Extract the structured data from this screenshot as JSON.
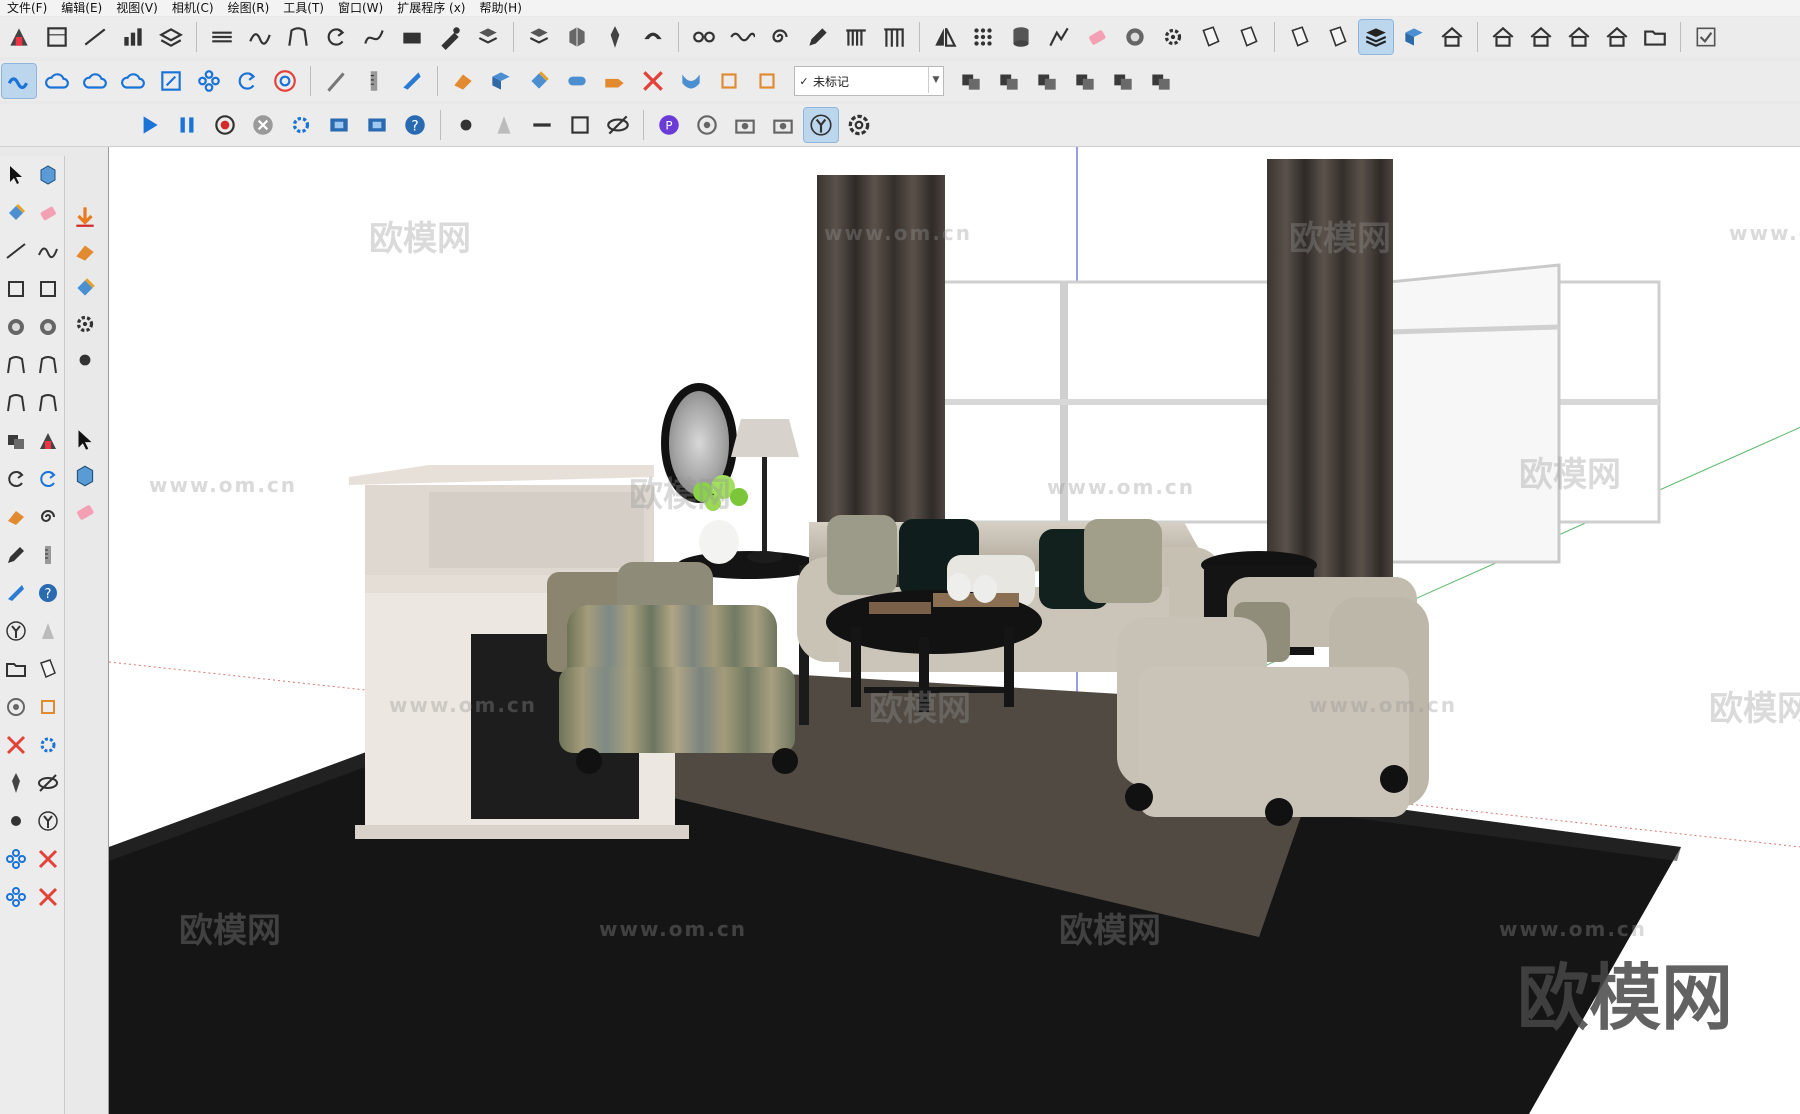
{
  "menu": [
    "文件(F)",
    "编辑(E)",
    "视图(V)",
    "相机(C)",
    "绘图(R)",
    "工具(T)",
    "窗口(W)",
    "扩展程序 (x)",
    "帮助(H)"
  ],
  "tag_dropdown": {
    "value": "未标记",
    "check": "✓"
  },
  "watermark": {
    "url": "www.om.cn",
    "brand": "欧模网",
    "corner": "欧模网"
  },
  "toolbar_icons": {
    "row1": [
      "push-pull-icon",
      "section-plane-icon",
      "line-icon",
      "bar-icon",
      "layer-stack-icon",
      "follow-me-icon",
      "curve-icon",
      "arc-icon",
      "rotate-icon",
      "path-icon",
      "box-icon",
      "pen-icon",
      "stack-icon",
      "stack-icon",
      "cube-icon",
      "pin-icon",
      "phone-icon",
      "chain-icon",
      "wave-icon",
      "spiral-icon",
      "pencil-icon",
      "railing-icon",
      "columns-icon",
      "mirror-icon",
      "dots-grid-icon",
      "cylinder-icon",
      "draw-icon",
      "eraser-icon",
      "badge-icon",
      "gear-icon",
      "sheet-icon",
      "sheet-icon",
      "sheet-icon",
      "sheet-icon",
      "layers-active-icon",
      "panel-icon",
      "house-icon",
      "house-icon",
      "house-icon",
      "house-icon",
      "house-icon",
      "folder-icon",
      "check-icon"
    ],
    "row2": [
      "join-icon",
      "cloud-icon",
      "cloud-icon",
      "cloud-icon",
      "frame-icon",
      "flower-icon",
      "refresh-icon",
      "chrome-icon",
      "knife-icon",
      "ruler-icon",
      "tape-icon",
      "extrude-icon",
      "panel-icon",
      "paint-icon",
      "pipe-icon",
      "tag-icon",
      "cut-icon",
      "ribbon-icon",
      "crop-icon",
      "crop-icon",
      "group-icon",
      "group-icon",
      "group-icon",
      "group-icon",
      "group-icon",
      "group-icon"
    ],
    "row3": [
      "play-icon",
      "pause-icon",
      "record-icon",
      "stop-icon",
      "settings-icon",
      "film-icon",
      "film-icon",
      "help-icon",
      "dot-icon",
      "cone-icon",
      "dash-icon",
      "square-icon",
      "hidden-eye-icon",
      "plugin-icon",
      "orbit-icon",
      "camera-icon",
      "camera-icon",
      "axis-icon",
      "flower-gear-icon"
    ]
  }
}
